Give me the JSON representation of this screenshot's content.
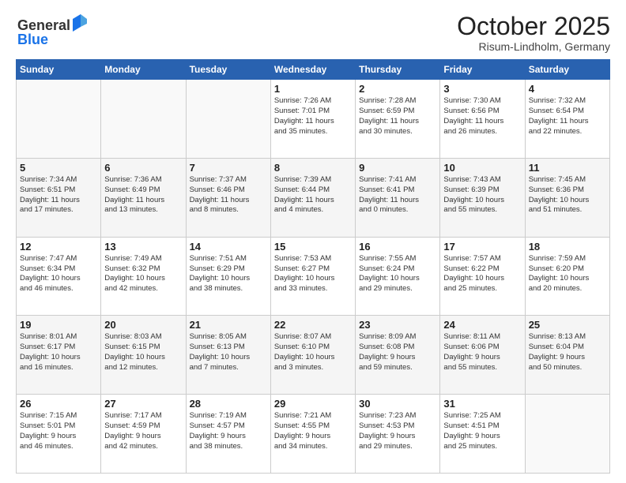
{
  "logo": {
    "line1": "General",
    "line2": "Blue"
  },
  "title": "October 2025",
  "subtitle": "Risum-Lindholm, Germany",
  "headers": [
    "Sunday",
    "Monday",
    "Tuesday",
    "Wednesday",
    "Thursday",
    "Friday",
    "Saturday"
  ],
  "weeks": [
    [
      {
        "day": "",
        "info": ""
      },
      {
        "day": "",
        "info": ""
      },
      {
        "day": "",
        "info": ""
      },
      {
        "day": "1",
        "info": "Sunrise: 7:26 AM\nSunset: 7:01 PM\nDaylight: 11 hours\nand 35 minutes."
      },
      {
        "day": "2",
        "info": "Sunrise: 7:28 AM\nSunset: 6:59 PM\nDaylight: 11 hours\nand 30 minutes."
      },
      {
        "day": "3",
        "info": "Sunrise: 7:30 AM\nSunset: 6:56 PM\nDaylight: 11 hours\nand 26 minutes."
      },
      {
        "day": "4",
        "info": "Sunrise: 7:32 AM\nSunset: 6:54 PM\nDaylight: 11 hours\nand 22 minutes."
      }
    ],
    [
      {
        "day": "5",
        "info": "Sunrise: 7:34 AM\nSunset: 6:51 PM\nDaylight: 11 hours\nand 17 minutes."
      },
      {
        "day": "6",
        "info": "Sunrise: 7:36 AM\nSunset: 6:49 PM\nDaylight: 11 hours\nand 13 minutes."
      },
      {
        "day": "7",
        "info": "Sunrise: 7:37 AM\nSunset: 6:46 PM\nDaylight: 11 hours\nand 8 minutes."
      },
      {
        "day": "8",
        "info": "Sunrise: 7:39 AM\nSunset: 6:44 PM\nDaylight: 11 hours\nand 4 minutes."
      },
      {
        "day": "9",
        "info": "Sunrise: 7:41 AM\nSunset: 6:41 PM\nDaylight: 11 hours\nand 0 minutes."
      },
      {
        "day": "10",
        "info": "Sunrise: 7:43 AM\nSunset: 6:39 PM\nDaylight: 10 hours\nand 55 minutes."
      },
      {
        "day": "11",
        "info": "Sunrise: 7:45 AM\nSunset: 6:36 PM\nDaylight: 10 hours\nand 51 minutes."
      }
    ],
    [
      {
        "day": "12",
        "info": "Sunrise: 7:47 AM\nSunset: 6:34 PM\nDaylight: 10 hours\nand 46 minutes."
      },
      {
        "day": "13",
        "info": "Sunrise: 7:49 AM\nSunset: 6:32 PM\nDaylight: 10 hours\nand 42 minutes."
      },
      {
        "day": "14",
        "info": "Sunrise: 7:51 AM\nSunset: 6:29 PM\nDaylight: 10 hours\nand 38 minutes."
      },
      {
        "day": "15",
        "info": "Sunrise: 7:53 AM\nSunset: 6:27 PM\nDaylight: 10 hours\nand 33 minutes."
      },
      {
        "day": "16",
        "info": "Sunrise: 7:55 AM\nSunset: 6:24 PM\nDaylight: 10 hours\nand 29 minutes."
      },
      {
        "day": "17",
        "info": "Sunrise: 7:57 AM\nSunset: 6:22 PM\nDaylight: 10 hours\nand 25 minutes."
      },
      {
        "day": "18",
        "info": "Sunrise: 7:59 AM\nSunset: 6:20 PM\nDaylight: 10 hours\nand 20 minutes."
      }
    ],
    [
      {
        "day": "19",
        "info": "Sunrise: 8:01 AM\nSunset: 6:17 PM\nDaylight: 10 hours\nand 16 minutes."
      },
      {
        "day": "20",
        "info": "Sunrise: 8:03 AM\nSunset: 6:15 PM\nDaylight: 10 hours\nand 12 minutes."
      },
      {
        "day": "21",
        "info": "Sunrise: 8:05 AM\nSunset: 6:13 PM\nDaylight: 10 hours\nand 7 minutes."
      },
      {
        "day": "22",
        "info": "Sunrise: 8:07 AM\nSunset: 6:10 PM\nDaylight: 10 hours\nand 3 minutes."
      },
      {
        "day": "23",
        "info": "Sunrise: 8:09 AM\nSunset: 6:08 PM\nDaylight: 9 hours\nand 59 minutes."
      },
      {
        "day": "24",
        "info": "Sunrise: 8:11 AM\nSunset: 6:06 PM\nDaylight: 9 hours\nand 55 minutes."
      },
      {
        "day": "25",
        "info": "Sunrise: 8:13 AM\nSunset: 6:04 PM\nDaylight: 9 hours\nand 50 minutes."
      }
    ],
    [
      {
        "day": "26",
        "info": "Sunrise: 7:15 AM\nSunset: 5:01 PM\nDaylight: 9 hours\nand 46 minutes."
      },
      {
        "day": "27",
        "info": "Sunrise: 7:17 AM\nSunset: 4:59 PM\nDaylight: 9 hours\nand 42 minutes."
      },
      {
        "day": "28",
        "info": "Sunrise: 7:19 AM\nSunset: 4:57 PM\nDaylight: 9 hours\nand 38 minutes."
      },
      {
        "day": "29",
        "info": "Sunrise: 7:21 AM\nSunset: 4:55 PM\nDaylight: 9 hours\nand 34 minutes."
      },
      {
        "day": "30",
        "info": "Sunrise: 7:23 AM\nSunset: 4:53 PM\nDaylight: 9 hours\nand 29 minutes."
      },
      {
        "day": "31",
        "info": "Sunrise: 7:25 AM\nSunset: 4:51 PM\nDaylight: 9 hours\nand 25 minutes."
      },
      {
        "day": "",
        "info": ""
      }
    ]
  ]
}
